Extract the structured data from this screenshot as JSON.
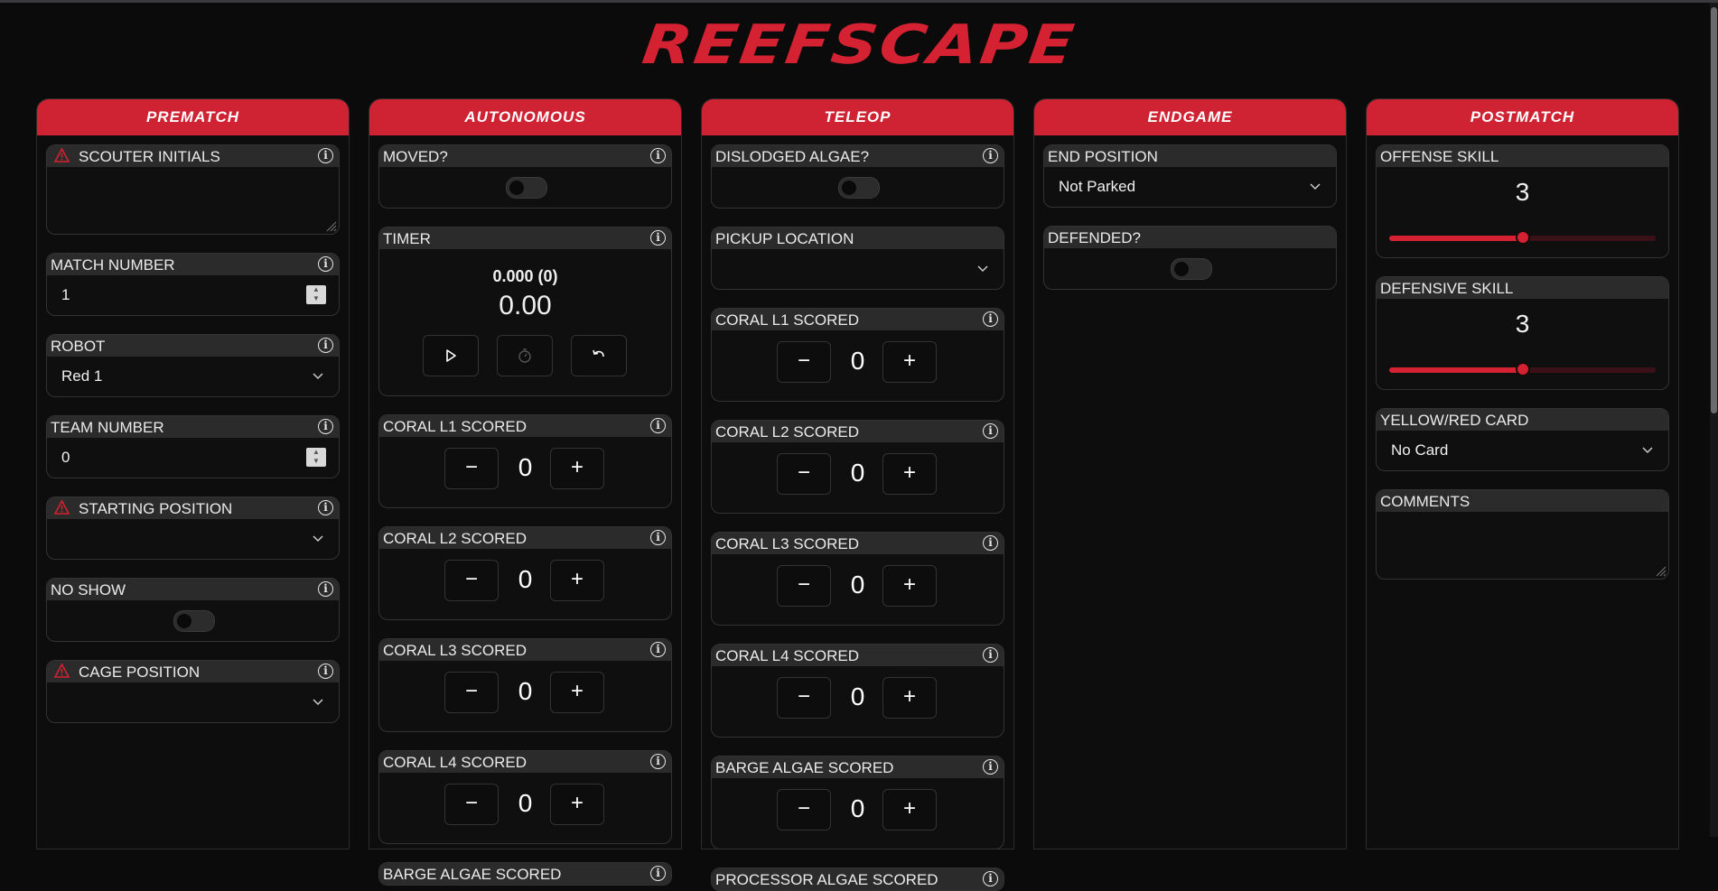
{
  "title": "REEFSCAPE",
  "colors": {
    "accent": "#cf2233",
    "background": "#0b0b0b",
    "card_header": "#2b2b2b"
  },
  "icons": {
    "info": "info-icon",
    "warning": "warning-icon",
    "chevron": "chevron-down-icon"
  },
  "prematch": {
    "title": "PREMATCH",
    "scouter_initials": {
      "label": "SCOUTER INITIALS",
      "value": ""
    },
    "match_number": {
      "label": "MATCH NUMBER",
      "value": "1"
    },
    "robot": {
      "label": "ROBOT",
      "value": "Red 1"
    },
    "team_number": {
      "label": "TEAM NUMBER",
      "value": "0"
    },
    "starting_position": {
      "label": "STARTING POSITION",
      "value": ""
    },
    "no_show": {
      "label": "NO SHOW",
      "on": false
    },
    "cage_position": {
      "label": "CAGE POSITION",
      "value": ""
    }
  },
  "autonomous": {
    "title": "AUTONOMOUS",
    "moved": {
      "label": "MOVED?",
      "on": false
    },
    "timer": {
      "label": "TIMER",
      "summary": "0.000 (0)",
      "value": "0.00"
    },
    "coral_l1": {
      "label": "CORAL L1 SCORED",
      "value": "0"
    },
    "coral_l2": {
      "label": "CORAL L2 SCORED",
      "value": "0"
    },
    "coral_l3": {
      "label": "CORAL L3 SCORED",
      "value": "0"
    },
    "coral_l4": {
      "label": "CORAL L4 SCORED",
      "value": "0"
    },
    "barge_algae": {
      "label": "BARGE ALGAE SCORED"
    }
  },
  "teleop": {
    "title": "TELEOP",
    "dislodged_algae": {
      "label": "DISLODGED ALGAE?",
      "on": false
    },
    "pickup_location": {
      "label": "PICKUP LOCATION",
      "value": ""
    },
    "coral_l1": {
      "label": "CORAL L1 SCORED",
      "value": "0"
    },
    "coral_l2": {
      "label": "CORAL L2 SCORED",
      "value": "0"
    },
    "coral_l3": {
      "label": "CORAL L3 SCORED",
      "value": "0"
    },
    "coral_l4": {
      "label": "CORAL L4 SCORED",
      "value": "0"
    },
    "barge_algae": {
      "label": "BARGE ALGAE SCORED",
      "value": "0"
    },
    "processor_algae": {
      "label": "PROCESSOR ALGAE SCORED"
    }
  },
  "endgame": {
    "title": "ENDGAME",
    "end_position": {
      "label": "END POSITION",
      "value": "Not Parked"
    },
    "defended": {
      "label": "DEFENDED?",
      "on": false
    }
  },
  "postmatch": {
    "title": "POSTMATCH",
    "offense_skill": {
      "label": "OFFENSE SKILL",
      "value": "3",
      "level": 0.5
    },
    "defensive_skill": {
      "label": "DEFENSIVE SKILL",
      "value": "3",
      "level": 0.5
    },
    "card": {
      "label": "YELLOW/RED CARD",
      "value": "No Card"
    },
    "comments": {
      "label": "COMMENTS",
      "value": ""
    }
  },
  "controls": {
    "minus": "−",
    "plus": "+"
  }
}
